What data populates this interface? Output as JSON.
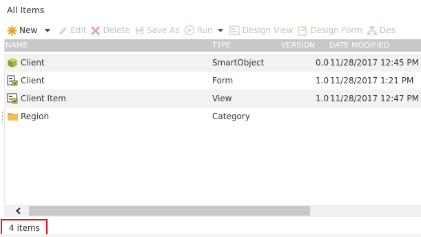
{
  "window": {
    "title": "All Items"
  },
  "toolbar": {
    "new_label": "New",
    "edit_label": "Edit",
    "delete_label": "Delete",
    "save_as_label": "Save As",
    "run_label": "Run",
    "design_view_label": "Design View",
    "design_form_label": "Design Form",
    "design_truncated_label": "Des"
  },
  "table": {
    "headers": {
      "name": "NAME",
      "type": "TYPE",
      "version": "VERSION",
      "date_modified": "DATE MODIFIED"
    },
    "rows": [
      {
        "icon": "smartobject-icon",
        "name": "Client",
        "type": "SmartObject",
        "version": "0.0",
        "date": "11/28/2017 12:45 PM"
      },
      {
        "icon": "form-icon",
        "name": "Client",
        "type": "Form",
        "version": "1.0",
        "date": "11/28/2017 1:21 PM"
      },
      {
        "icon": "view-icon",
        "name": "Client Item",
        "type": "View",
        "version": "1.0",
        "date": "11/28/2017 12:47 PM"
      },
      {
        "icon": "folder-icon",
        "name": "Region",
        "type": "Category",
        "version": "",
        "date": ""
      }
    ]
  },
  "footer": {
    "item_count": "4 items"
  },
  "colors": {
    "accent_new": "#f0a020",
    "highlight_border": "#e0141e",
    "header_bg": "#c8c8c8"
  }
}
